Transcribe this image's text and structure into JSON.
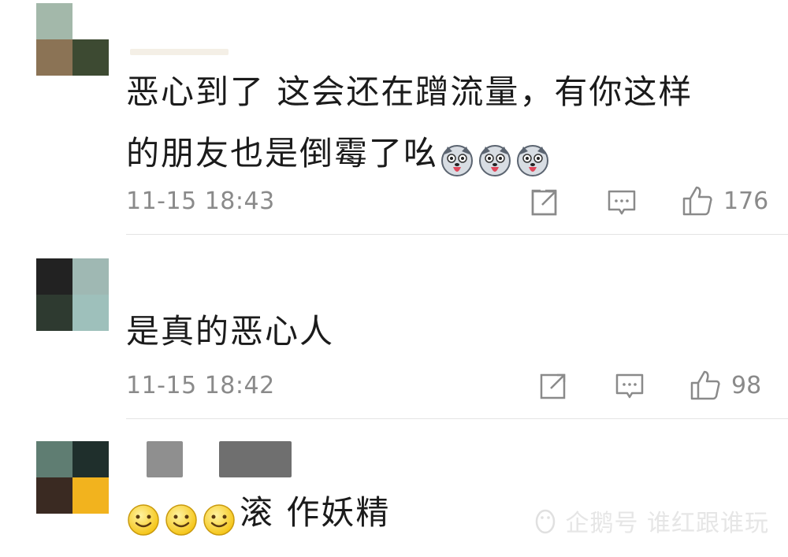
{
  "comments": [
    {
      "text_line1": "恶心到了  这会还在蹭流量，有你这样",
      "text_line2": "的朋友也是倒霉了吆",
      "timestamp": "11-15 18:43",
      "likes": "176",
      "emoji": "husky-tongue-emoji",
      "emoji_count": 3
    },
    {
      "text": "是真的恶心人",
      "timestamp": "11-15 18:42",
      "likes": "98"
    },
    {
      "text": "滚 作妖精",
      "emoji": "smile-emoji",
      "emoji_count": 3
    }
  ],
  "watermark": {
    "text": "企鹅号 谁红跟谁玩"
  },
  "colors": {
    "text": "#1b1b1b",
    "meta": "#8a8a8a",
    "divider": "#e4e4e4"
  }
}
